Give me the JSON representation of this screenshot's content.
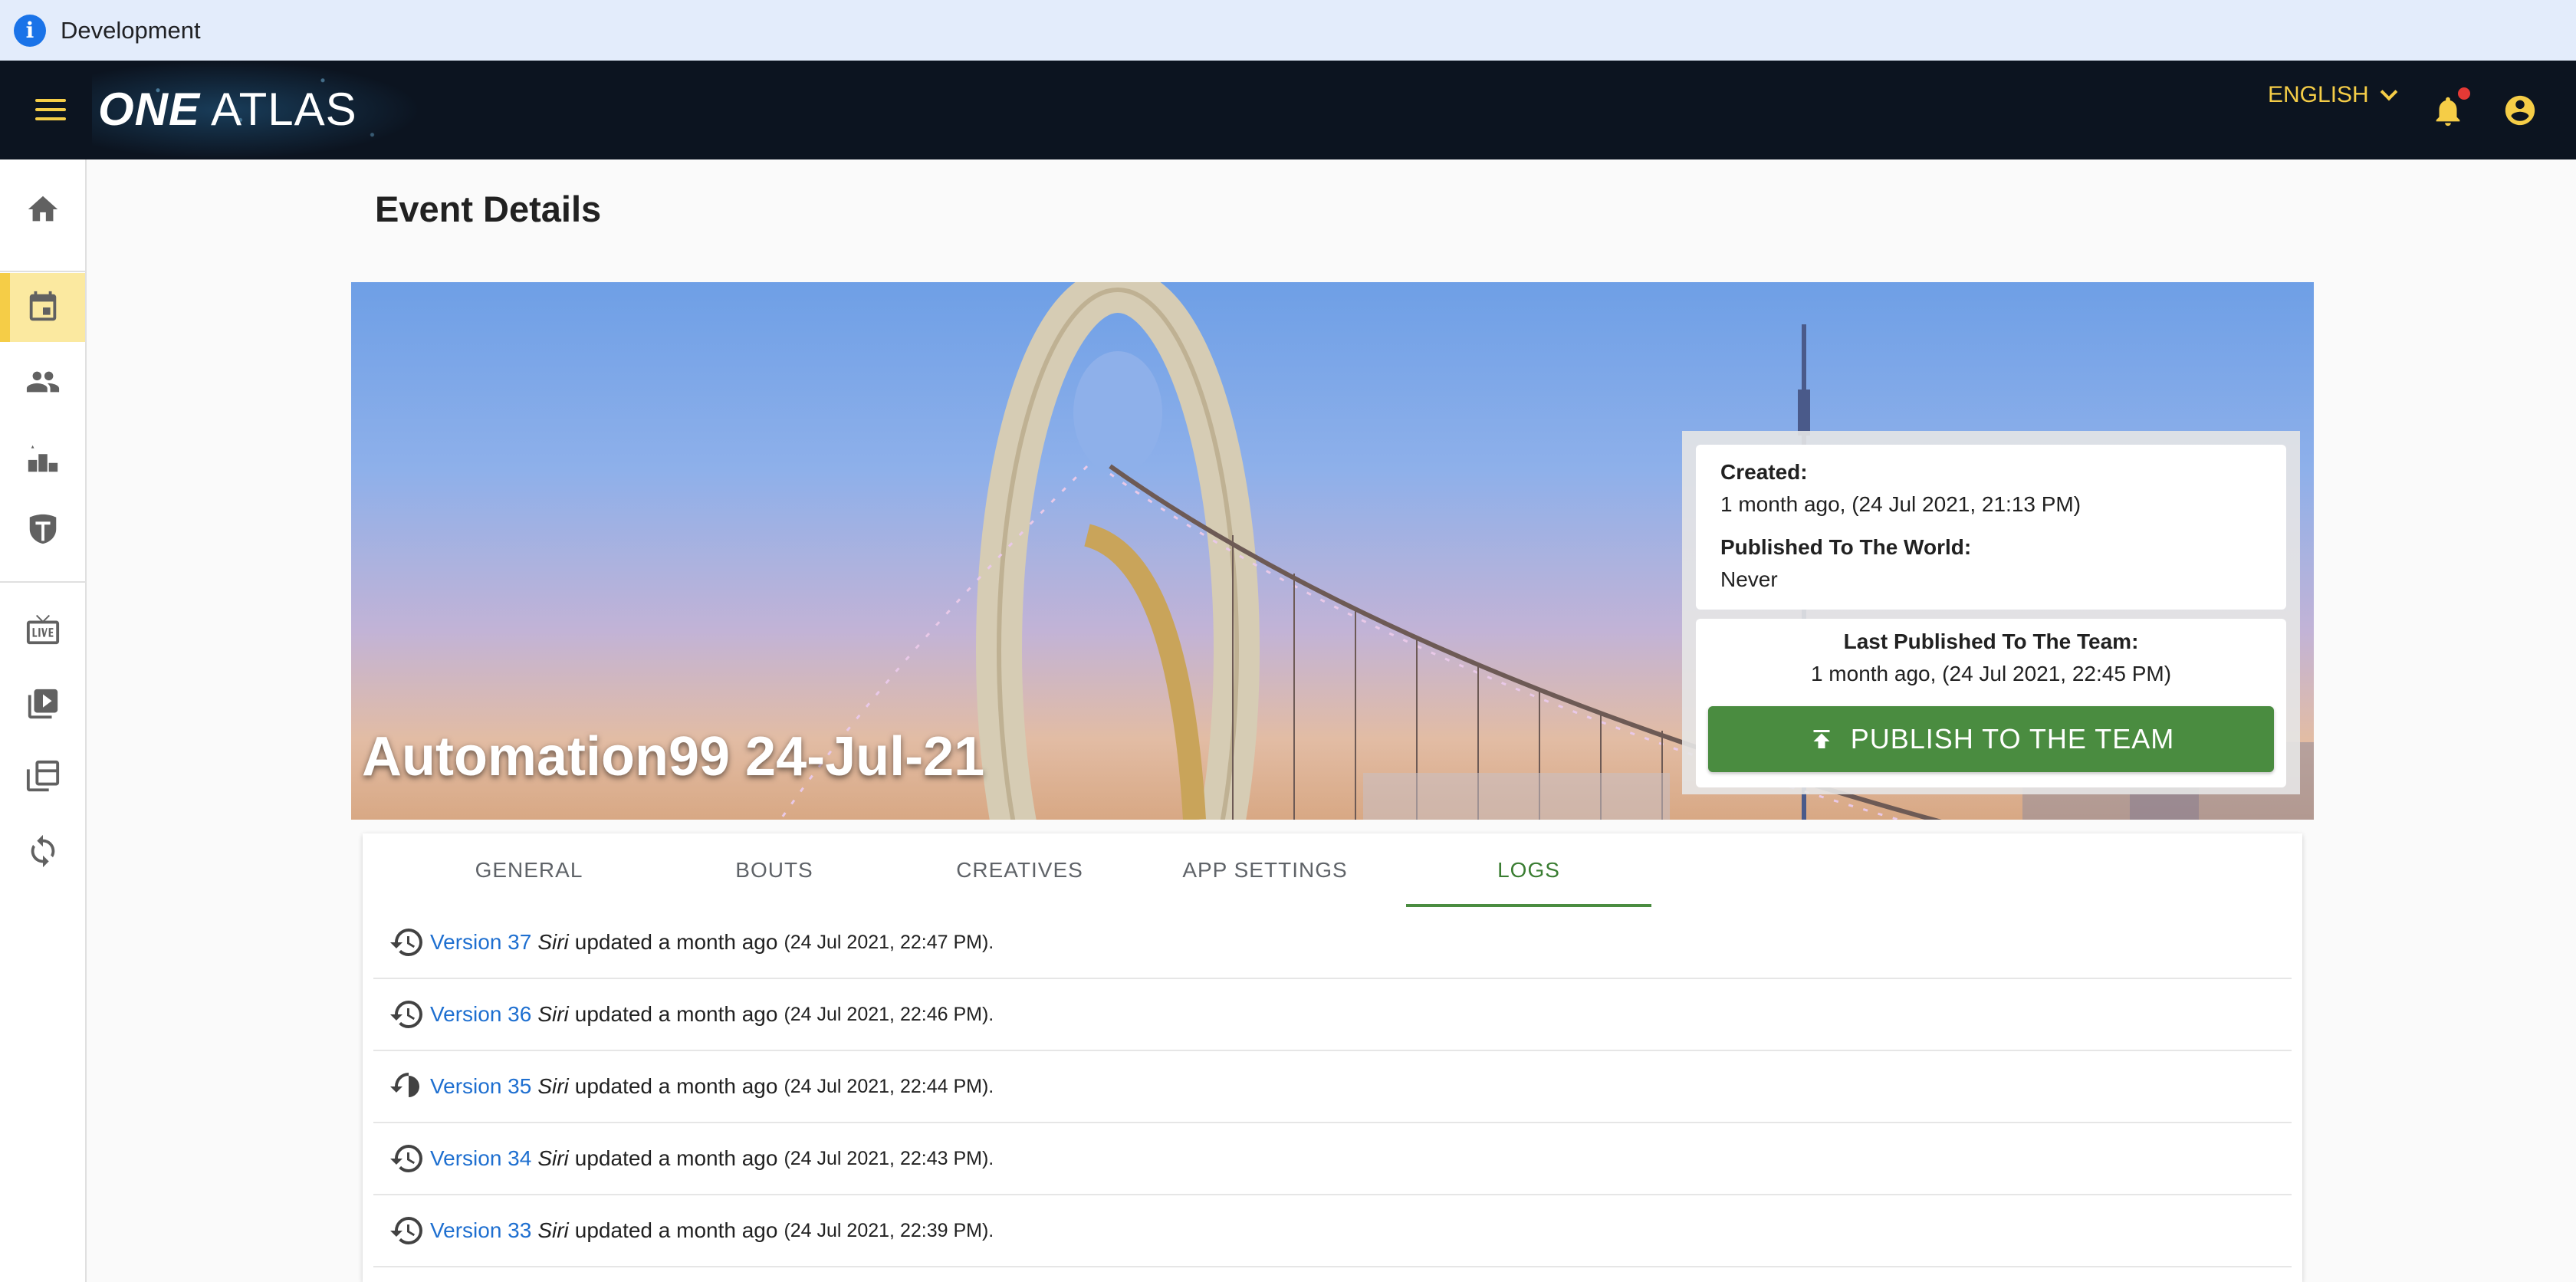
{
  "environment": {
    "label": "Development",
    "icon": "info-icon"
  },
  "header": {
    "logo_one": "ONE",
    "logo_atlas": "ATLAS",
    "language": "ENGLISH",
    "icons": [
      "menu-icon",
      "bell-icon",
      "account-circle-icon"
    ],
    "brand_color": "#f5cd47"
  },
  "sidebar": {
    "items": [
      {
        "name": "home",
        "icon": "home-icon",
        "active": false
      },
      {
        "name": "events",
        "icon": "calendar-icon",
        "active": true
      },
      {
        "name": "people",
        "icon": "people-icon",
        "active": false
      },
      {
        "name": "rankings",
        "icon": "podium-icon",
        "active": false
      },
      {
        "name": "shield",
        "icon": "shield-icon",
        "active": false
      },
      {
        "name": "live",
        "icon": "live-tv-icon",
        "active": false
      },
      {
        "name": "videos",
        "icon": "video-library-icon",
        "active": false
      },
      {
        "name": "collections",
        "icon": "collections-icon",
        "active": false
      },
      {
        "name": "sync",
        "icon": "sync-icon",
        "active": false
      }
    ]
  },
  "page": {
    "title": "Event Details"
  },
  "event": {
    "name": "Automation99 24-Jul-21",
    "created_label": "Created:",
    "created_value": "1 month ago, (24 Jul 2021, 21:13 PM)",
    "world_label": "Published To The World:",
    "world_value": "Never",
    "team_label": "Last Published To The Team:",
    "team_value": "1 month ago, (24 Jul 2021, 22:45 PM)",
    "publish_button": "PUBLISH TO THE TEAM",
    "publish_color": "#4a8c40"
  },
  "tabs": [
    {
      "label": "GENERAL",
      "active": false
    },
    {
      "label": "BOUTS",
      "active": false
    },
    {
      "label": "CREATIVES",
      "active": false
    },
    {
      "label": "APP SETTINGS",
      "active": false
    },
    {
      "label": "LOGS",
      "active": true
    }
  ],
  "logs": [
    {
      "version": "Version 37",
      "user": "Siri",
      "action": "updated a month ago",
      "date": "(24 Jul 2021, 22:47 PM)."
    },
    {
      "version": "Version 36",
      "user": "Siri",
      "action": "updated a month ago",
      "date": "(24 Jul 2021, 22:46 PM)."
    },
    {
      "version": "Version 35",
      "user": "Siri",
      "action": "updated a month ago",
      "date": "(24 Jul 2021, 22:44 PM)."
    },
    {
      "version": "Version 34",
      "user": "Siri",
      "action": "updated a month ago",
      "date": "(24 Jul 2021, 22:43 PM)."
    },
    {
      "version": "Version 33",
      "user": "Siri",
      "action": "updated a month ago",
      "date": "(24 Jul 2021, 22:39 PM)."
    }
  ]
}
